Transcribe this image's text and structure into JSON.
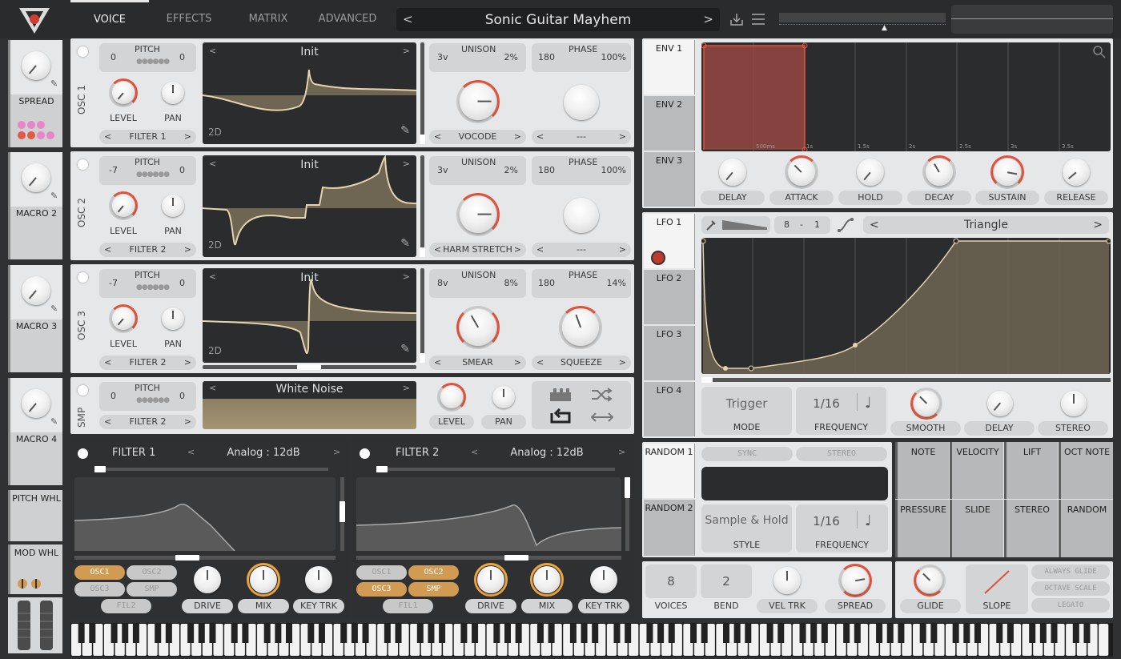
{
  "tabs": [
    "VOICE",
    "EFFECTS",
    "MATRIX",
    "ADVANCED"
  ],
  "preset": {
    "name": "Sonic Guitar Mayhem",
    "prev": "<",
    "next": ">"
  },
  "macros": [
    {
      "label": "SPREAD"
    },
    {
      "label": "MACRO 2"
    },
    {
      "label": "MACRO 3"
    },
    {
      "label": "MACRO 4"
    }
  ],
  "wheels": {
    "pitch": "PITCH WHL",
    "mod": "MOD WHL"
  },
  "osc": [
    {
      "name": "OSC 1",
      "pitch_left": "0",
      "pitch_right": "0",
      "pitch_label": "PITCH",
      "level": "LEVEL",
      "pan": "PAN",
      "filter": "FILTER 1",
      "wavetable": "Init",
      "dim": "2D",
      "unison_voices": "3v",
      "unison_detune": "2%",
      "unison_label": "UNISON",
      "phase": "180",
      "phase_rand": "100%",
      "phase_label": "PHASE",
      "warp": "VOCODE",
      "warp2": "---"
    },
    {
      "name": "OSC 2",
      "pitch_left": "-7",
      "pitch_right": "0",
      "pitch_label": "PITCH",
      "level": "LEVEL",
      "pan": "PAN",
      "filter": "FILTER 2",
      "wavetable": "Init",
      "dim": "2D",
      "unison_voices": "3v",
      "unison_detune": "2%",
      "unison_label": "UNISON",
      "phase": "180",
      "phase_rand": "100%",
      "phase_label": "PHASE",
      "warp": "HARM STRETCH",
      "warp2": "---"
    },
    {
      "name": "OSC 3",
      "pitch_left": "-7",
      "pitch_right": "0",
      "pitch_label": "PITCH",
      "level": "LEVEL",
      "pan": "PAN",
      "filter": "FILTER 2",
      "wavetable": "Init",
      "dim": "2D",
      "unison_voices": "8v",
      "unison_detune": "8%",
      "unison_label": "UNISON",
      "phase": "180",
      "phase_rand": "14%",
      "phase_label": "PHASE",
      "warp": "SMEAR",
      "warp2": "SQUEEZE"
    }
  ],
  "smp": {
    "name": "SMP",
    "pitch_left": "0",
    "pitch_right": "0",
    "pitch_label": "PITCH",
    "filter": "FILTER 2",
    "sample": "White Noise",
    "level": "LEVEL",
    "pan": "PAN"
  },
  "filters": [
    {
      "title": "FILTER 1",
      "model": "Analog : 12dB",
      "drive": "DRIVE",
      "mix": "MIX",
      "keytrk": "KEY TRK",
      "routes": [
        {
          "label": "OSC1",
          "on": true
        },
        {
          "label": "OSC2",
          "on": false
        },
        {
          "label": "OSC3",
          "on": false
        },
        {
          "label": "SMP",
          "on": false
        },
        {
          "label": "FIL2",
          "on": false
        }
      ]
    },
    {
      "title": "FILTER 2",
      "model": "Analog : 12dB",
      "drive": "DRIVE",
      "mix": "MIX",
      "keytrk": "KEY TRK",
      "routes": [
        {
          "label": "OSC1",
          "on": false
        },
        {
          "label": "OSC2",
          "on": true
        },
        {
          "label": "OSC3",
          "on": true
        },
        {
          "label": "SMP",
          "on": true
        },
        {
          "label": "FIL1",
          "on": false
        }
      ]
    }
  ],
  "env": {
    "tabs": [
      "ENV 1",
      "ENV 2",
      "ENV 3"
    ],
    "knobs": [
      "DELAY",
      "ATTACK",
      "HOLD",
      "DECAY",
      "SUSTAIN",
      "RELEASE"
    ],
    "time_labels": [
      "500ms",
      "1s",
      "1.5s",
      "2s",
      "2.5s",
      "3s",
      "3.5s"
    ]
  },
  "lfo": {
    "tabs": [
      "LFO 1",
      "LFO 2",
      "LFO 3",
      "LFO 4"
    ],
    "grid_left": "8",
    "grid_sep": "-",
    "grid_right": "1",
    "shape": "Triangle",
    "mode_value": "Trigger",
    "mode": "MODE",
    "freq_value": "1/16",
    "freq": "FREQUENCY",
    "smooth": "SMOOTH",
    "delay": "DELAY",
    "stereo": "STEREO"
  },
  "random": {
    "tabs": [
      "RANDOM 1",
      "RANDOM 2"
    ],
    "sync": "SYNC",
    "stereo": "STEREO",
    "style_value": "Sample & Hold",
    "style": "STYLE",
    "freq_value": "1/16",
    "freq": "FREQUENCY"
  },
  "mod_sources": [
    "NOTE",
    "VELOCITY",
    "LIFT",
    "OCT NOTE",
    "PRESSURE",
    "SLIDE",
    "STEREO",
    "RANDOM"
  ],
  "voice": {
    "voices_value": "8",
    "voices": "VOICES",
    "bend_value": "2",
    "bend": "BEND",
    "veltrk": "VEL TRK",
    "spread": "SPREAD"
  },
  "glide": {
    "glide": "GLIDE",
    "slope": "SLOPE",
    "always": "ALWAYS GLIDE",
    "octave": "OCTAVE SCALE",
    "legato": "LEGATO"
  },
  "colors": {
    "accent": "#e0523b",
    "orange": "#f0a53c",
    "wave": "#d8c7a2"
  }
}
